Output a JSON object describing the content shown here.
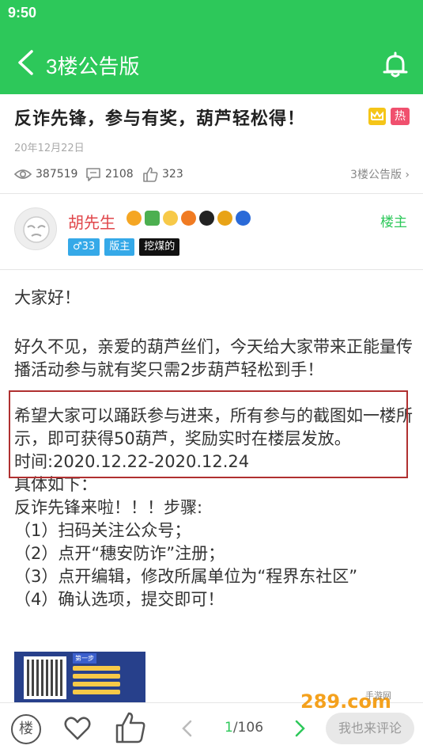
{
  "statusbar": {
    "time": "9:50"
  },
  "appbar": {
    "title": "3楼公告版"
  },
  "post": {
    "title": "反诈先锋，参与有奖，葫芦轻松得！",
    "badge_hot": "热",
    "date": "20年12月22日",
    "views": "387519",
    "comments": "2108",
    "likes": "323",
    "board_link": "3楼公告版 ›"
  },
  "author": {
    "name": "胡先生",
    "owner_tag": "楼主",
    "gender_level": "♂33",
    "mod_tag": "版主",
    "miner_tag": "挖煤的"
  },
  "content": {
    "lines": [
      "大家好！",
      "",
      "好久不见，亲爱的葫芦丝们，今天给大家带来正能量传播活动参与就有奖只需2步葫芦轻松到手！",
      "",
      "希望大家可以踊跃参与进来，所有参与的截图如一楼所示，即可获得50葫芦，奖励实时在楼层发放。",
      "时间:2020.12.22-2020.12.24",
      "具体如下：",
      "反诈先锋来啦！！！步骤:",
      "（1）扫码关注公众号；",
      "（2）点开“穗安防诈”注册；",
      "（3）点开编辑，修改所属单位为“程界东社区”",
      "（4）确认选项，提交即可！"
    ],
    "image_step_label": "第一步"
  },
  "bottombar": {
    "floor_label": "楼",
    "page_current": "1",
    "page_total": "/106",
    "comment_placeholder": "我也来评论"
  },
  "watermark": {
    "text": "289.com",
    "subtext": "手游网"
  },
  "colors": {
    "accent": "#2dc85a",
    "author_name": "#e0464a",
    "highlight_border": "#b03030"
  }
}
